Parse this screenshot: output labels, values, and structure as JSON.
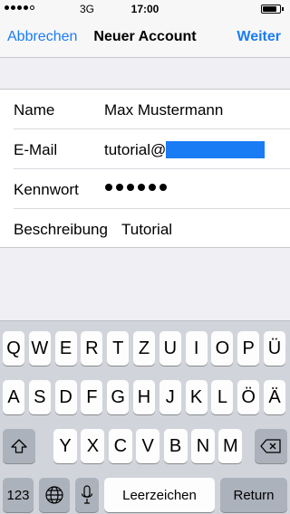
{
  "status_bar": {
    "network": "3G",
    "time": "17:00",
    "signal_bars_filled": 4,
    "signal_bars_total": 5,
    "battery_level": 0.85
  },
  "nav": {
    "cancel_label": "Abbrechen",
    "title": "Neuer Account",
    "next_label": "Weiter"
  },
  "form": {
    "name_label": "Name",
    "name_value": "Max Mustermann",
    "email_label": "E-Mail",
    "email_value": "tutorial@",
    "password_label": "Kennwort",
    "password_length": 6,
    "description_label": "Beschreibung",
    "description_value": "Tutorial"
  },
  "keyboard": {
    "row1": [
      "Q",
      "W",
      "E",
      "R",
      "T",
      "Z",
      "U",
      "I",
      "O",
      "P",
      "Ü"
    ],
    "row2": [
      "A",
      "S",
      "D",
      "F",
      "G",
      "H",
      "J",
      "K",
      "L",
      "Ö",
      "Ä"
    ],
    "row3": [
      "Y",
      "X",
      "C",
      "V",
      "B",
      "N",
      "M"
    ],
    "numbers_label": "123",
    "space_label": "Leerzeichen",
    "return_label": "Return"
  },
  "colors": {
    "accent": "#1a7cf5",
    "redaction": "#1a7cf5",
    "grouped_background": "#efeff4",
    "keyboard_background": "#d1d5db"
  }
}
